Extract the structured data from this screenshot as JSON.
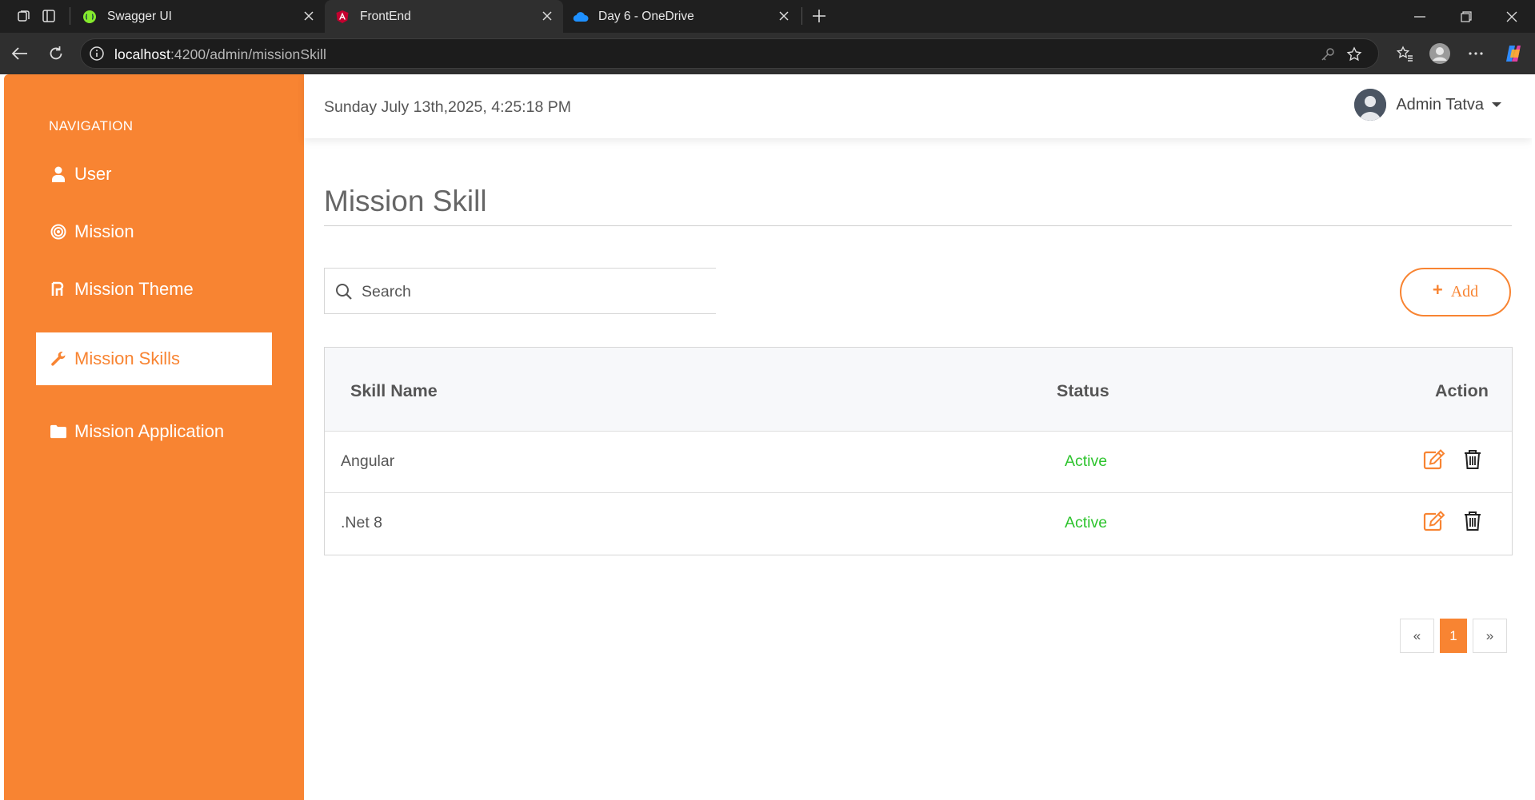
{
  "browser": {
    "tabs": [
      {
        "title": "Swagger UI",
        "active": false
      },
      {
        "title": "FrontEnd",
        "active": true
      },
      {
        "title": "Day 6 - OneDrive",
        "active": false
      }
    ],
    "url_host": "localhost",
    "url_path": ":4200/admin/missionSkill"
  },
  "sidebar": {
    "heading": "NAVIGATION",
    "items": [
      {
        "label": "User",
        "icon": "user-icon"
      },
      {
        "label": "Mission",
        "icon": "target-icon"
      },
      {
        "label": "Mission Theme",
        "icon": "theme-icon"
      },
      {
        "label": "Mission Skills",
        "icon": "wrench-icon",
        "active": true
      },
      {
        "label": "Mission Application",
        "icon": "folder-icon"
      }
    ]
  },
  "header": {
    "datetime": "Sunday July 13th,2025, 4:25:18 PM",
    "user_name": "Admin Tatva"
  },
  "main": {
    "title": "Mission Skill",
    "search_placeholder": "Search",
    "add_label": "Add",
    "table": {
      "columns": [
        "Skill Name",
        "Status",
        "Action"
      ],
      "rows": [
        {
          "skill": "Angular",
          "status": "Active"
        },
        {
          "skill": ".Net 8",
          "status": "Active"
        }
      ]
    },
    "pagination": {
      "prev": "«",
      "current": "1",
      "next": "»"
    }
  },
  "colors": {
    "accent": "#f88432",
    "status_active": "#2ec42e"
  }
}
